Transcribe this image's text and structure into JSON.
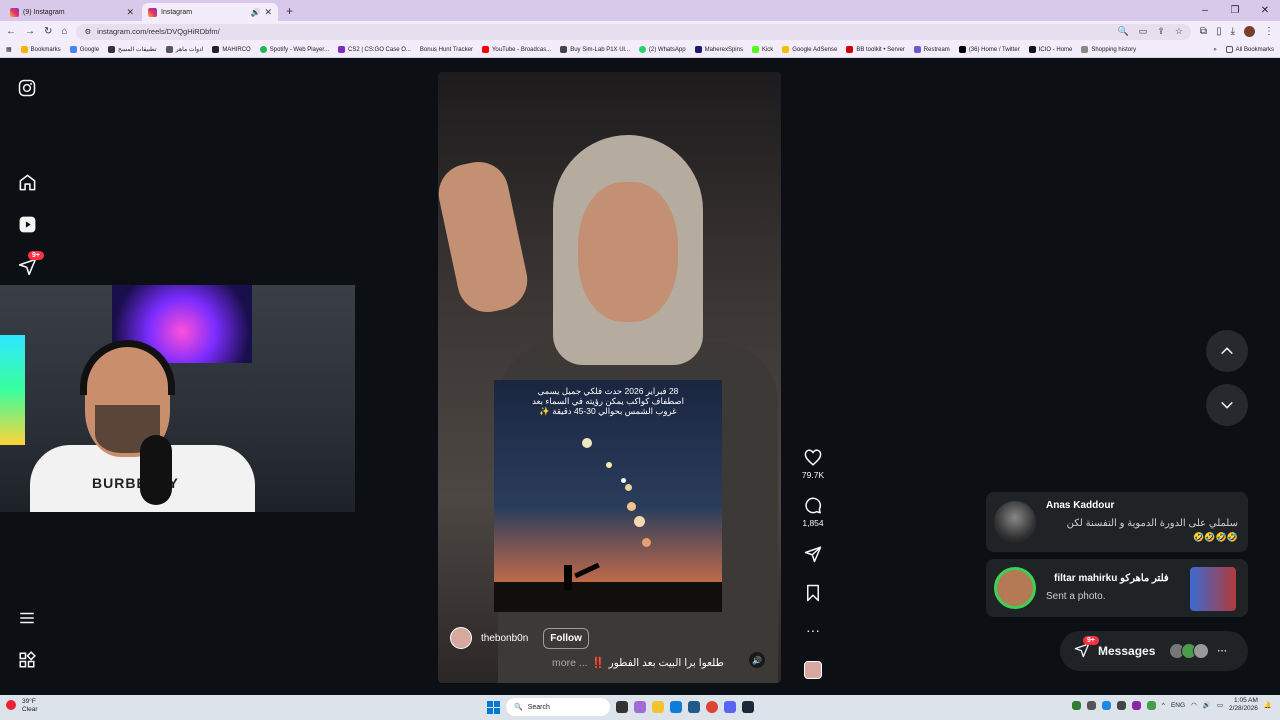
{
  "browser": {
    "tabs": [
      {
        "label": "(9) Instagram",
        "active": false
      },
      {
        "label": "Instagram",
        "active": true
      }
    ],
    "url": "instagram.com/reels/DVQgHiRDbfm/",
    "bookmarks": [
      "Bookmarks",
      "Google",
      "تطبيقات المسح",
      "ادوات ماهر",
      "MAHIRCO",
      "Spotify - Web Player...",
      "CS2 | CS:GO Case O...",
      "Bonus Hunt Tracker",
      "YouTube - Broadcas...",
      "Buy Sim-Lab P1X Ul...",
      "(2) WhatsApp",
      "MaherexSpins",
      "Kick",
      "Google AdSense",
      "BB toolkit • Server",
      "Restream",
      "(36) Home / Twitter",
      "ICIO - Home",
      "Shopping history"
    ],
    "all_bookmarks": "All Bookmarks"
  },
  "nav": {
    "notification_badge": "9+"
  },
  "reel": {
    "overlay_text": "28 فبراير 2026 حدث فلكي جميل يسمى اصطفاف كواكب يمكن رؤيته في السماء بعد غروب الشمس بحوالي 30-45 دقيقة ✨",
    "author": "thebonb0n",
    "follow": "Follow",
    "caption": "طلعوا برا البيت بعد الفطور",
    "caption_emoji": "‼️",
    "more": "more ..."
  },
  "actions": {
    "likes": "79.7K",
    "comments": "1,854"
  },
  "notifications": [
    {
      "name": "Anas Kaddour",
      "message": "سلملي على الدورة الدموية و التفسنة لكن",
      "emojis": "🤣🤣🤣🤣"
    },
    {
      "name": "filtar mahirku فلتر ماهركو",
      "message": "Sent a photo."
    }
  ],
  "messages": {
    "label": "Messages",
    "badge": "9+"
  },
  "taskbar": {
    "temp": "39°F",
    "weather": "Clear",
    "search": "Search",
    "lang": "ENG",
    "time": "1:05 AM",
    "date": "2/28/2026"
  }
}
